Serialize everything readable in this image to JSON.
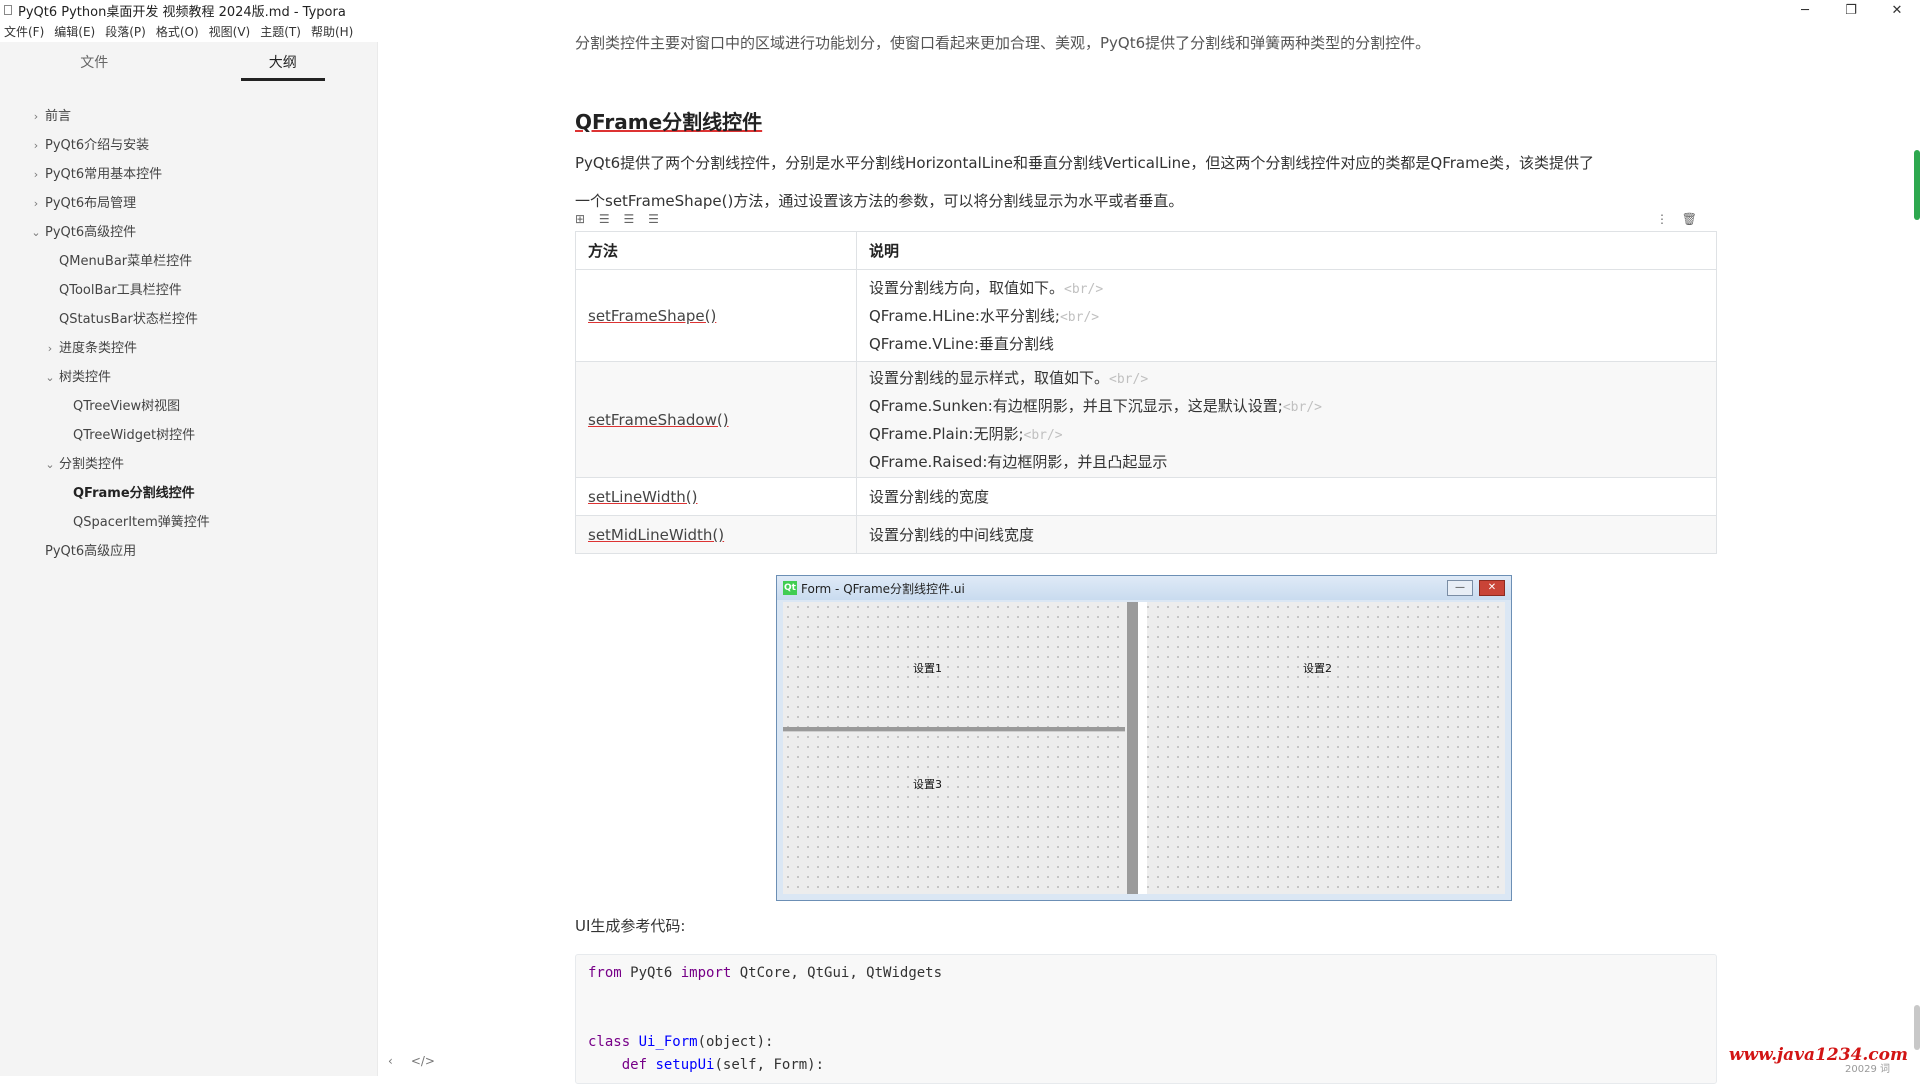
{
  "window": {
    "title": "PyQt6 Python桌面开发 视频教程 2024版.md - Typora",
    "controls": {
      "minimize": "─",
      "restore": "❐",
      "close": "✕"
    }
  },
  "menu": [
    "文件(F)",
    "编辑(E)",
    "段落(P)",
    "格式(O)",
    "视图(V)",
    "主题(T)",
    "帮助(H)"
  ],
  "sidebar": {
    "tabs": [
      {
        "label": "文件",
        "active": false
      },
      {
        "label": "大纲",
        "active": true
      }
    ],
    "outline": [
      {
        "label": "前言",
        "level": 0,
        "arrow": "›"
      },
      {
        "label": "PyQt6介绍与安装",
        "level": 0,
        "arrow": "›"
      },
      {
        "label": "PyQt6常用基本控件",
        "level": 0,
        "arrow": "›"
      },
      {
        "label": "PyQt6布局管理",
        "level": 0,
        "arrow": "›"
      },
      {
        "label": "PyQt6高级控件",
        "level": 0,
        "arrow": "⌄"
      },
      {
        "label": "QMenuBar菜单栏控件",
        "level": 1,
        "arrow": ""
      },
      {
        "label": "QToolBar工具栏控件",
        "level": 1,
        "arrow": ""
      },
      {
        "label": "QStatusBar状态栏控件",
        "level": 1,
        "arrow": ""
      },
      {
        "label": "进度条类控件",
        "level": 1,
        "arrow": "›"
      },
      {
        "label": "树类控件",
        "level": 1,
        "arrow": "⌄"
      },
      {
        "label": "QTreeView树视图",
        "level": 2,
        "arrow": ""
      },
      {
        "label": "QTreeWidget树控件",
        "level": 2,
        "arrow": ""
      },
      {
        "label": "分割类控件",
        "level": 1,
        "arrow": "⌄"
      },
      {
        "label": "QFrame分割线控件",
        "level": 2,
        "arrow": "",
        "active": true
      },
      {
        "label": "QSpacerItem弹簧控件",
        "level": 2,
        "arrow": ""
      },
      {
        "label": "PyQt6高级应用",
        "level": 0,
        "arrow": ""
      }
    ],
    "footer": {
      "back": "‹",
      "source": "</>"
    }
  },
  "content": {
    "cut_text": "分割类控件主要对窗口中的区域进行功能划分，使窗口看起来更加合理、美观，PyQt6提供了分割线和弹簧两种类型的分割控件。",
    "heading": "QFrame分割线控件",
    "para1": "PyQt6提供了两个分割线控件，分别是水平分割线HorizontalLine和垂直分割线VerticalLine，但这两个分割线控件对应的类都是QFrame类，该类提供了",
    "para2": "一个setFrameShape()方法，通过设置该方法的参数，可以将分割线显示为水平或者垂直。",
    "table_tools": {
      "left": [
        "⊞",
        "☰",
        "☰",
        "☰"
      ],
      "more": "⋮",
      "delete": "🗑"
    },
    "table": {
      "headers": [
        "方法",
        "说明"
      ],
      "rows": [
        {
          "method": "setFrameShape()",
          "lines": [
            {
              "text": "设置分割线方向，取值如下。",
              "tag": "<br/>"
            },
            {
              "text": "QFrame.HLine:水平分割线;",
              "tag": "<br/>"
            },
            {
              "text": "QFrame.VLine:垂直分割线",
              "tag": ""
            }
          ]
        },
        {
          "method": "setFrameShadow()",
          "lines": [
            {
              "text": "设置分割线的显示样式，取值如下。",
              "tag": "<br/>"
            },
            {
              "text": "QFrame.Sunken:有边框阴影，并且下沉显示，这是默认设置;",
              "tag": "<br/>"
            },
            {
              "text": "QFrame.Plain:无阴影;",
              "tag": "<br/>"
            },
            {
              "text": "QFrame.Raised:有边框阴影，并且凸起显示",
              "tag": ""
            }
          ]
        },
        {
          "method": "setLineWidth()",
          "lines": [
            {
              "text": "设置分割线的宽度",
              "tag": ""
            }
          ]
        },
        {
          "method": "setMidLineWidth()",
          "lines": [
            {
              "text": "设置分割线的中间线宽度",
              "tag": ""
            }
          ]
        }
      ]
    },
    "qt_form": {
      "title": "Form - QFrame分割线控件.ui",
      "logo": "Qt",
      "labels": [
        "设置1",
        "设置2",
        "设置3"
      ],
      "min_btn": "—",
      "close_btn": "✕"
    },
    "code_label": "UI生成参考代码:",
    "code": [
      "from PyQt6 import QtCore, QtGui, QtWidgets",
      "",
      "",
      "class Ui_Form(object):",
      "    def setupUi(self, Form):"
    ]
  },
  "watermark": {
    "text": "www.java1234.com",
    "sub": "20029 词"
  }
}
